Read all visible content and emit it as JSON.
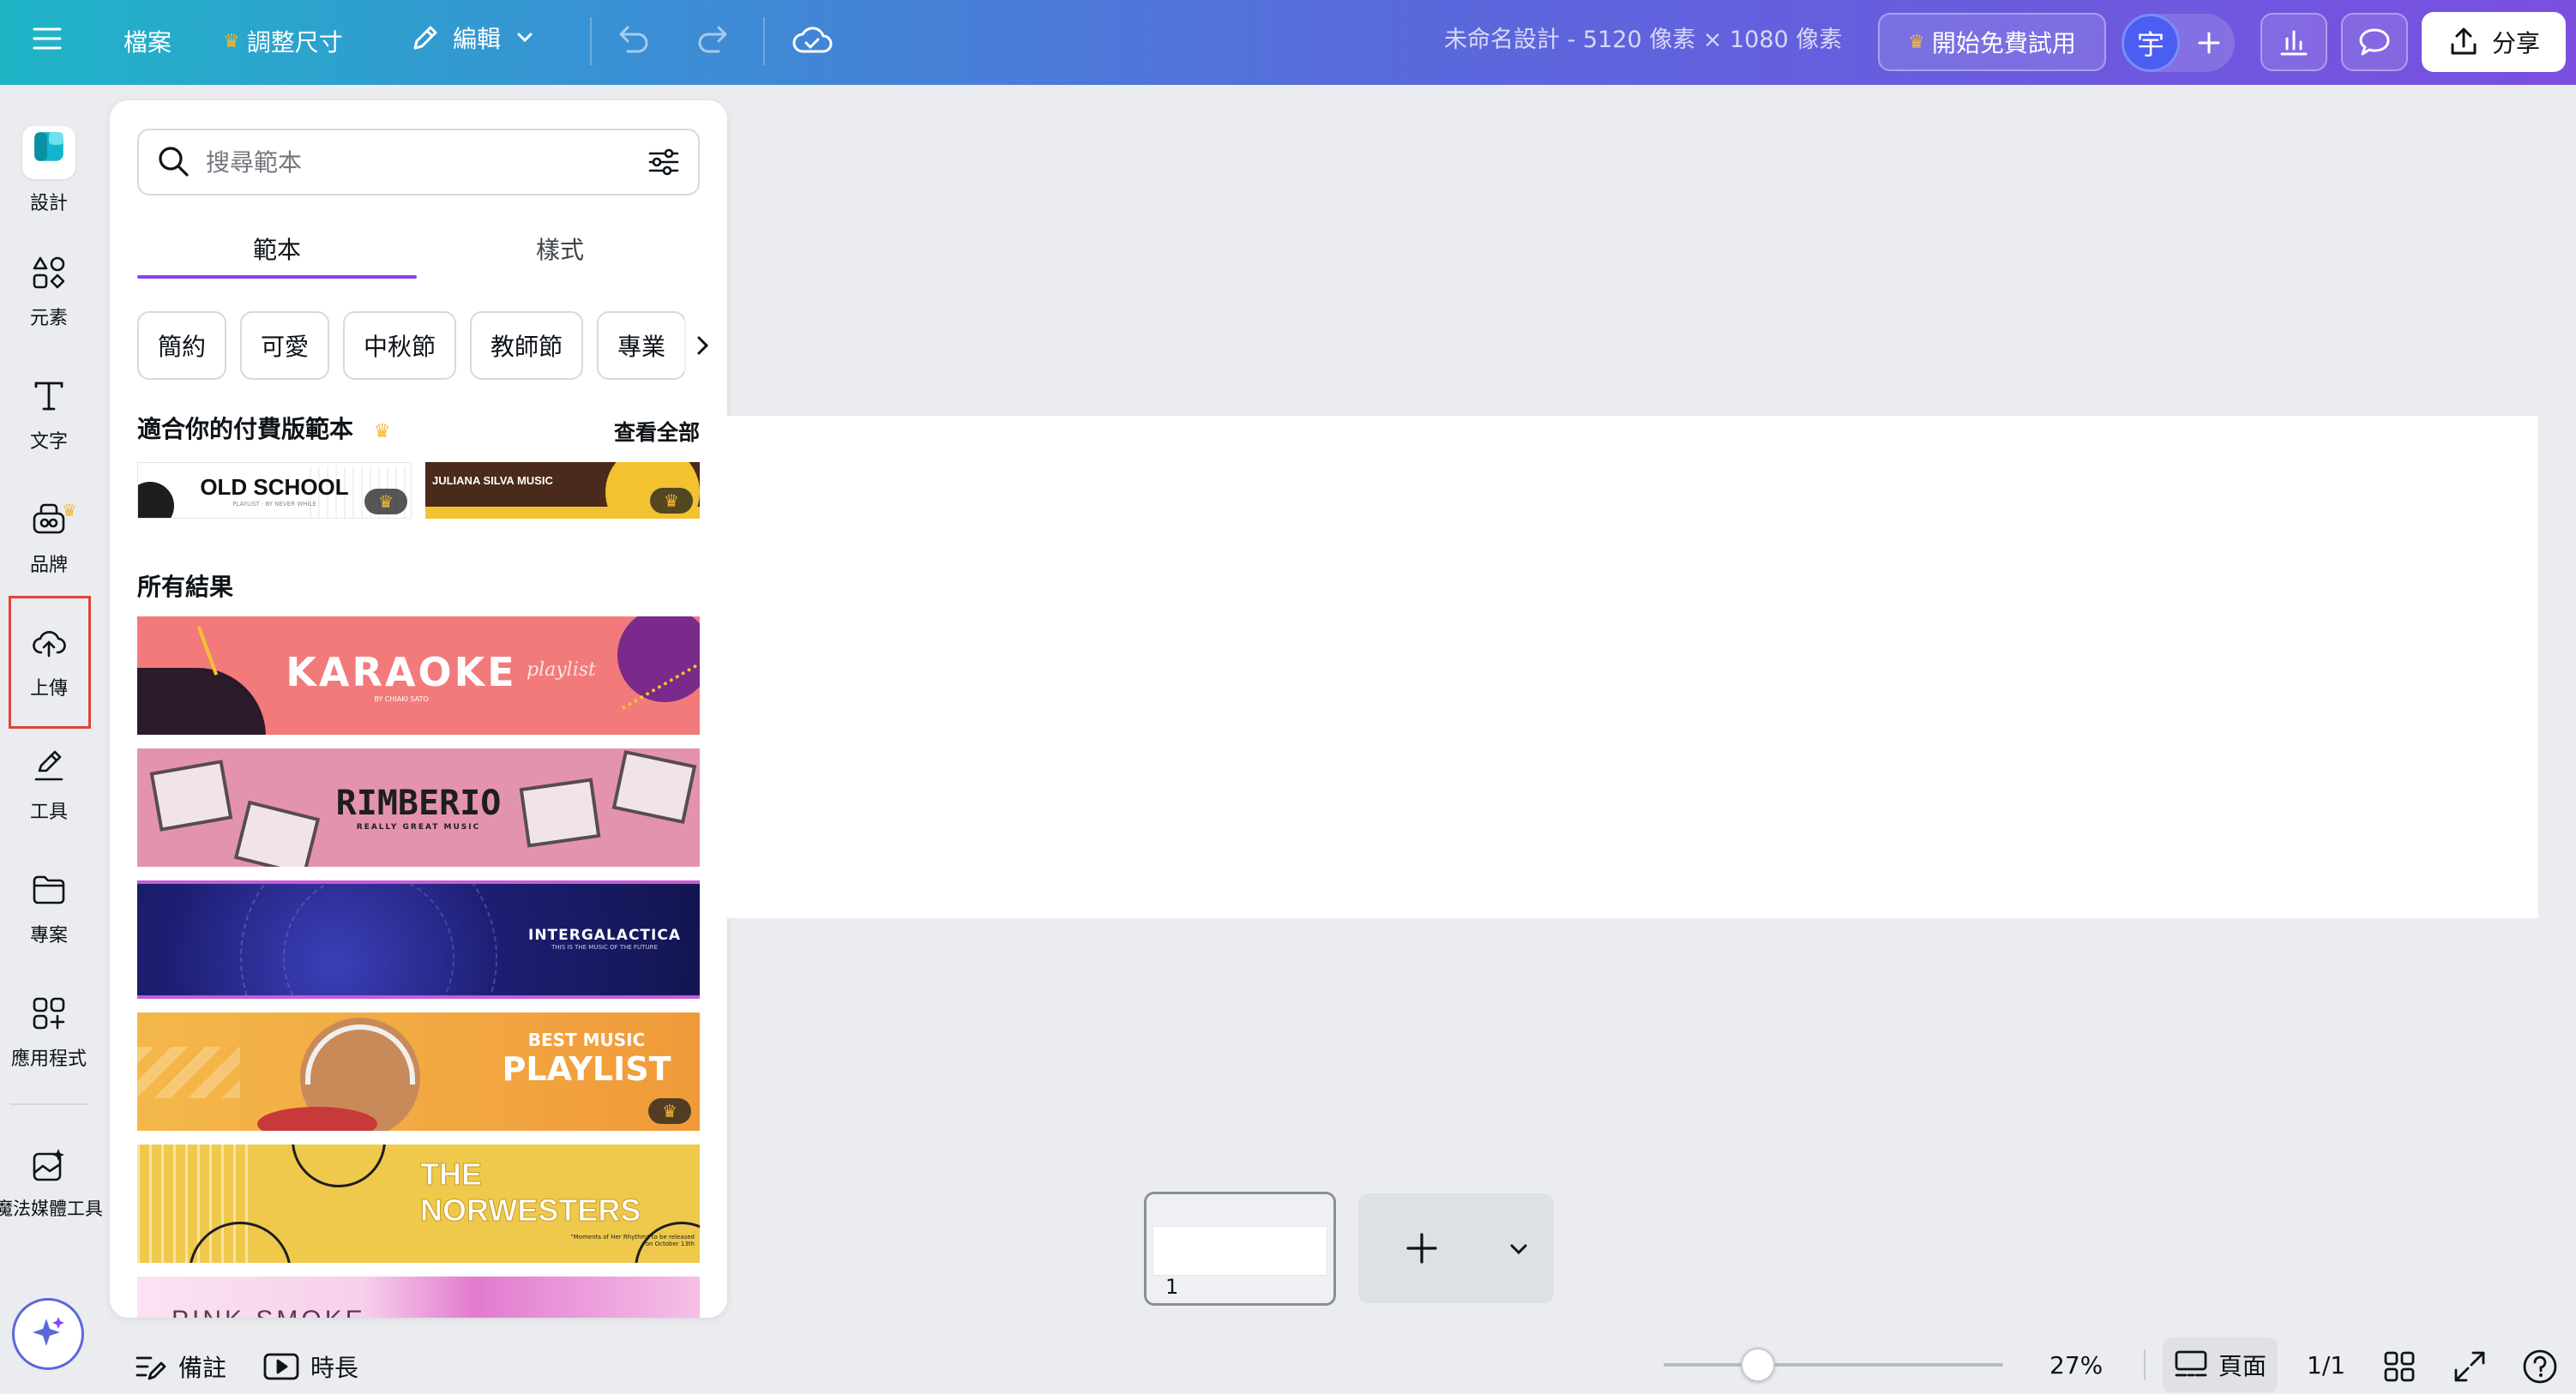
{
  "topbar": {
    "file_label": "檔案",
    "resize_label": "調整尺寸",
    "edit_label": "編輯",
    "doc_title": "未命名設計 - 5120 像素 × 1080 像素",
    "trial_label": "開始免費試用",
    "avatar_initial": "宇",
    "share_label": "分享"
  },
  "rail": {
    "items": [
      {
        "label": "設計",
        "icon": "design-icon"
      },
      {
        "label": "元素",
        "icon": "elements-icon"
      },
      {
        "label": "文字",
        "icon": "text-icon"
      },
      {
        "label": "品牌",
        "icon": "brand-icon"
      },
      {
        "label": "上傳",
        "icon": "upload-cloud-icon"
      },
      {
        "label": "工具",
        "icon": "draw-tool-icon"
      },
      {
        "label": "專案",
        "icon": "folder-icon"
      },
      {
        "label": "應用程式",
        "icon": "apps-icon"
      },
      {
        "label": "魔法媒體工具",
        "icon": "magic-media-icon"
      }
    ]
  },
  "panel": {
    "search_placeholder": "搜尋範本",
    "tabs": [
      "範本",
      "樣式"
    ],
    "chips": [
      "簡約",
      "可愛",
      "中秋節",
      "教師節",
      "專業"
    ],
    "premium_title": "適合你的付費版範本",
    "see_all": "查看全部",
    "premium_templates": [
      {
        "text": "OLD SCHOOL",
        "sub": "PLAYLIST · BY NEVER WHILE"
      },
      {
        "text": "JULIANA SILVA MUSIC"
      }
    ],
    "all_results_title": "所有結果",
    "templates": [
      {
        "title": "KARAOKE",
        "sub": "BY CHIAKI SATO",
        "script": "playlist"
      },
      {
        "title": "RIMBERIO",
        "sub": "REALLY GREAT MUSIC"
      },
      {
        "title": "INTERGALACTICA",
        "sub": "THIS IS THE MUSIC OF THE FUTURE"
      },
      {
        "title": "PLAYLIST",
        "sub": "BEST MUSIC"
      },
      {
        "title": "THE NORWESTERS",
        "sub": "\"Moments of Her Rhythm\" to be released on October 13th"
      },
      {
        "title": "PINK SMOKE"
      }
    ]
  },
  "canvas": {
    "page_number": "1"
  },
  "bottombar": {
    "notes_label": "備註",
    "duration_label": "時長",
    "zoom": "27%",
    "page_view_label": "頁面",
    "page_count": "1/1"
  },
  "colors": {
    "accent": "#8b3dff",
    "gold": "#f7b731",
    "highlight": "#e0433a"
  }
}
